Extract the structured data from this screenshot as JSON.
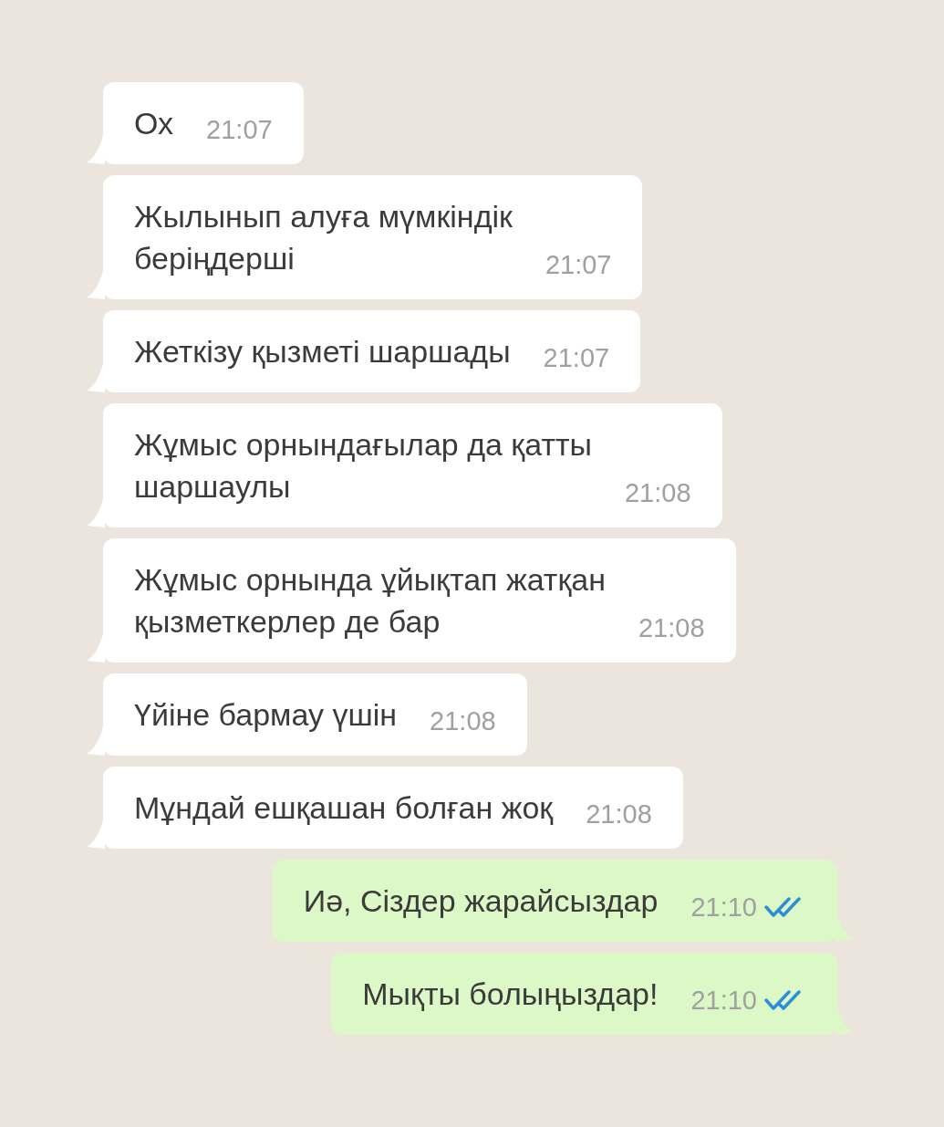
{
  "messages": [
    {
      "kind": "incoming",
      "text": "Ох",
      "time": "21:07"
    },
    {
      "kind": "incoming",
      "text": "Жылынып алуға мүмкіндік\nберіңдерші",
      "time": "21:07"
    },
    {
      "kind": "incoming",
      "text": "Жеткізу қызметі шаршады",
      "time": "21:07"
    },
    {
      "kind": "incoming",
      "text": "Жұмыс орнындағылар да қатты\nшаршаулы",
      "time": "21:08"
    },
    {
      "kind": "incoming",
      "text": "Жұмыс орнында ұйықтап жатқан\nқызметкерлер де бар",
      "time": "21:08"
    },
    {
      "kind": "incoming",
      "text": "Үйіне бармау үшін",
      "time": "21:08"
    },
    {
      "kind": "incoming",
      "text": "Мұндай ешқашан болған жоқ",
      "time": "21:08"
    },
    {
      "kind": "outgoing",
      "text": "Иә, Сіздер жарайсыздар",
      "time": "21:10",
      "read": true
    },
    {
      "kind": "outgoing",
      "text": "Мықты болыңыздар!",
      "time": "21:10",
      "read": true
    }
  ]
}
